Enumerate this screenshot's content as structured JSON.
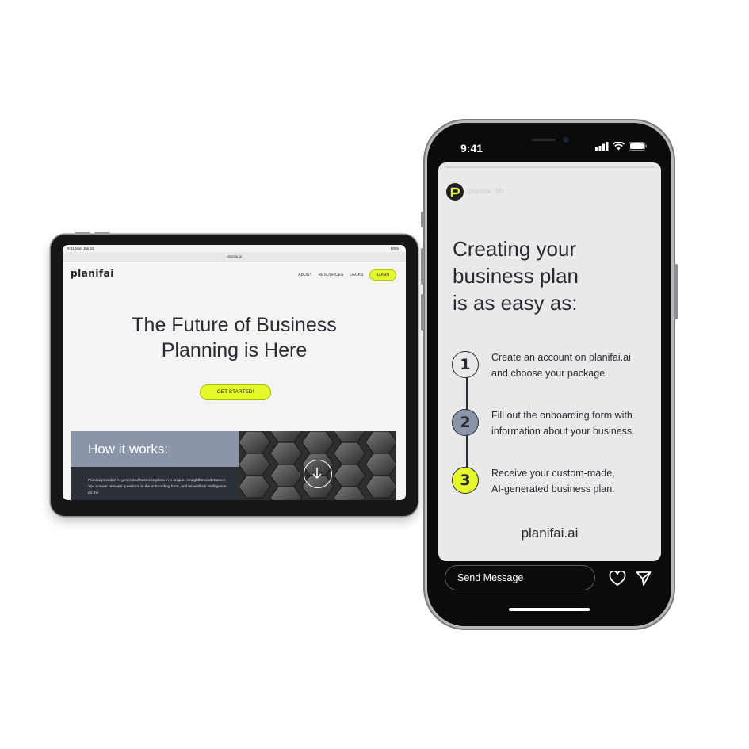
{
  "tablet": {
    "status_left": "9:41  Mon Jun 22",
    "status_right": "100%",
    "url": "planifai.ai",
    "logo": "planifai",
    "nav": [
      "ABOUT",
      "RESOURCES",
      "DECKS"
    ],
    "login_label": "LOGIN",
    "hero_line1": "The Future of Business",
    "hero_line2": "Planning is Here",
    "cta_label": "GET STARTED!",
    "how_title": "How it works:",
    "how_text": "Planifai provides AI generated business plans in a unique, straightforward manner.  You answer relevant questions in the onboarding form, and let artificial intelligence do the",
    "accent": "#e4f82a"
  },
  "phone": {
    "time": "9:41",
    "username": "planifai",
    "post_age": "5h",
    "headline_line1": "Creating your",
    "headline_line2": "business plan",
    "headline_line3": "is as easy as:",
    "steps": [
      {
        "number": "1",
        "line1": "Create an account on planifai.ai",
        "line2": "and choose your package.",
        "color": "#e9e9e9"
      },
      {
        "number": "2",
        "line1": "Fill out the onboarding form with",
        "line2": "information about your business.",
        "color": "#8b95aa"
      },
      {
        "number": "3",
        "line1": "Receive your custom-made,",
        "line2": "AI-generated business plan.",
        "color": "#e4f82a"
      }
    ],
    "brand": "planifai.ai",
    "send_placeholder": "Send Message",
    "icons": [
      "heart-icon",
      "paper-plane-icon"
    ]
  }
}
